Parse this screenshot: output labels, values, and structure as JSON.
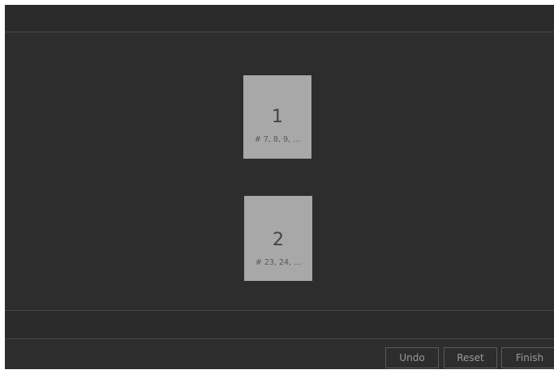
{
  "pages": [
    {
      "number": "1",
      "pages_label": "# 7, 8, 9, ..."
    },
    {
      "number": "2",
      "pages_label": "# 23, 24, ..."
    }
  ],
  "actions": {
    "undo_label": "Undo",
    "reset_label": "Reset",
    "finish_label": "Finish"
  },
  "colors": {
    "background": "#2d2d2d",
    "card": "#a8a8a8",
    "divider": "#474747",
    "button_border": "#5a5a5a",
    "button_text": "#9a9a9a"
  }
}
